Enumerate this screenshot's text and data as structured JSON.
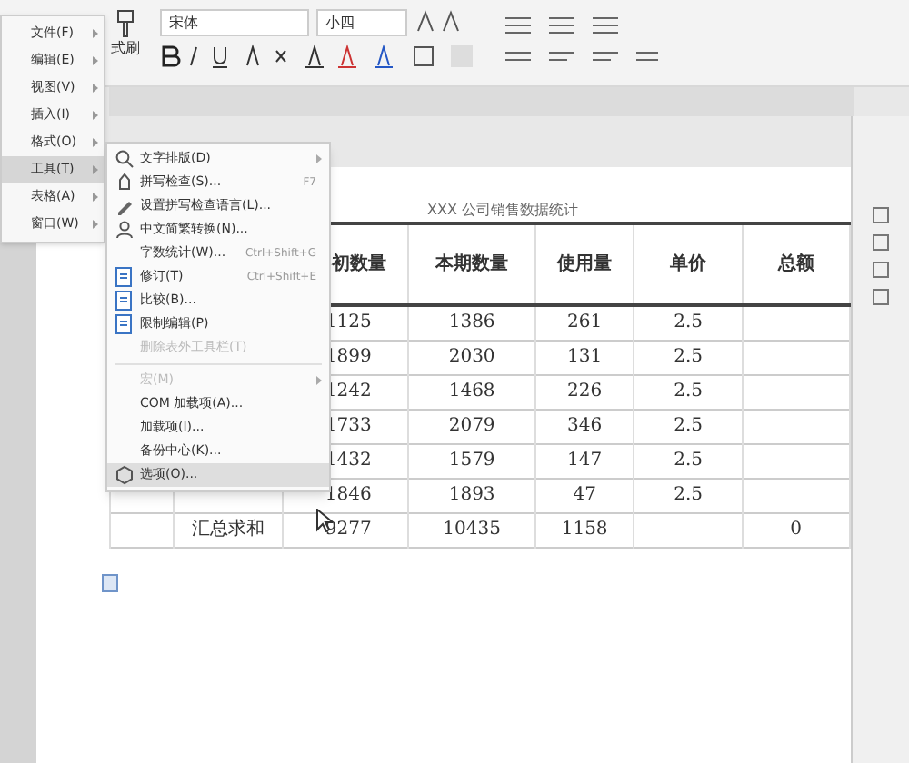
{
  "main_menu": [
    {
      "label": "文件(F)",
      "selected": false
    },
    {
      "label": "编辑(E)",
      "selected": false
    },
    {
      "label": "视图(V)",
      "selected": false
    },
    {
      "label": "插入(I)",
      "selected": false
    },
    {
      "label": "格式(O)",
      "selected": false
    },
    {
      "label": "工具(T)",
      "selected": true
    },
    {
      "label": "表格(A)",
      "selected": false
    },
    {
      "label": "窗口(W)",
      "selected": false
    }
  ],
  "tools_menu": [
    {
      "label": "文字排版(D)",
      "submenu": true,
      "disabled": false,
      "selected": false
    },
    {
      "label": "拼写检查(S)...",
      "shortcut": "F7",
      "submenu": false,
      "disabled": false,
      "selected": false
    },
    {
      "label": "设置拼写检查语言(L)...",
      "submenu": false,
      "disabled": false,
      "selected": false
    },
    {
      "label": "中文简繁转换(N)...",
      "submenu": false,
      "disabled": false,
      "selected": false
    },
    {
      "label": "字数统计(W)...",
      "shortcut": "Ctrl+Shift+G",
      "submenu": false,
      "disabled": false,
      "selected": false
    },
    {
      "label": "修订(T)",
      "shortcut": "Ctrl+Shift+E",
      "submenu": false,
      "disabled": false,
      "selected": false
    },
    {
      "label": "比较(B)...",
      "submenu": false,
      "disabled": false,
      "selected": false
    },
    {
      "label": "限制编辑(P)",
      "submenu": false,
      "disabled": false,
      "selected": false
    },
    {
      "label": "删除表外工具栏(T)",
      "submenu": false,
      "disabled": true,
      "selected": false
    },
    {
      "label": "宏(M)",
      "submenu": true,
      "disabled": true,
      "selected": false
    },
    {
      "label": "COM 加载项(A)...",
      "submenu": false,
      "disabled": false,
      "selected": false
    },
    {
      "label": "加载项(I)...",
      "submenu": false,
      "disabled": false,
      "selected": false
    },
    {
      "label": "备份中心(K)...",
      "submenu": false,
      "disabled": false,
      "selected": false
    },
    {
      "label": "选项(O)...",
      "submenu": false,
      "disabled": false,
      "selected": true
    }
  ],
  "toolbar": {
    "format_painter": "式刷",
    "font": "宋体",
    "font_size": "小四"
  },
  "document": {
    "title": "XXX 公司销售数据统计",
    "columns": [
      null,
      null,
      "初数量",
      "本期数量",
      "使用量",
      "单价",
      "总额"
    ],
    "rows": [
      [
        null,
        null,
        "1125",
        "1386",
        "261",
        "2.5",
        null
      ],
      [
        null,
        null,
        "1899",
        "2030",
        "131",
        "2.5",
        null
      ],
      [
        null,
        null,
        "1242",
        "1468",
        "226",
        "2.5",
        null
      ],
      [
        null,
        null,
        "1733",
        "2079",
        "346",
        "2.5",
        null
      ],
      [
        null,
        null,
        "1432",
        "1579",
        "147",
        "2.5",
        null
      ],
      [
        null,
        null,
        "1846",
        "1893",
        "47",
        "2.5",
        null
      ],
      [
        null,
        "汇总求和",
        "9277",
        "10435",
        "1158",
        null,
        "0"
      ]
    ]
  }
}
